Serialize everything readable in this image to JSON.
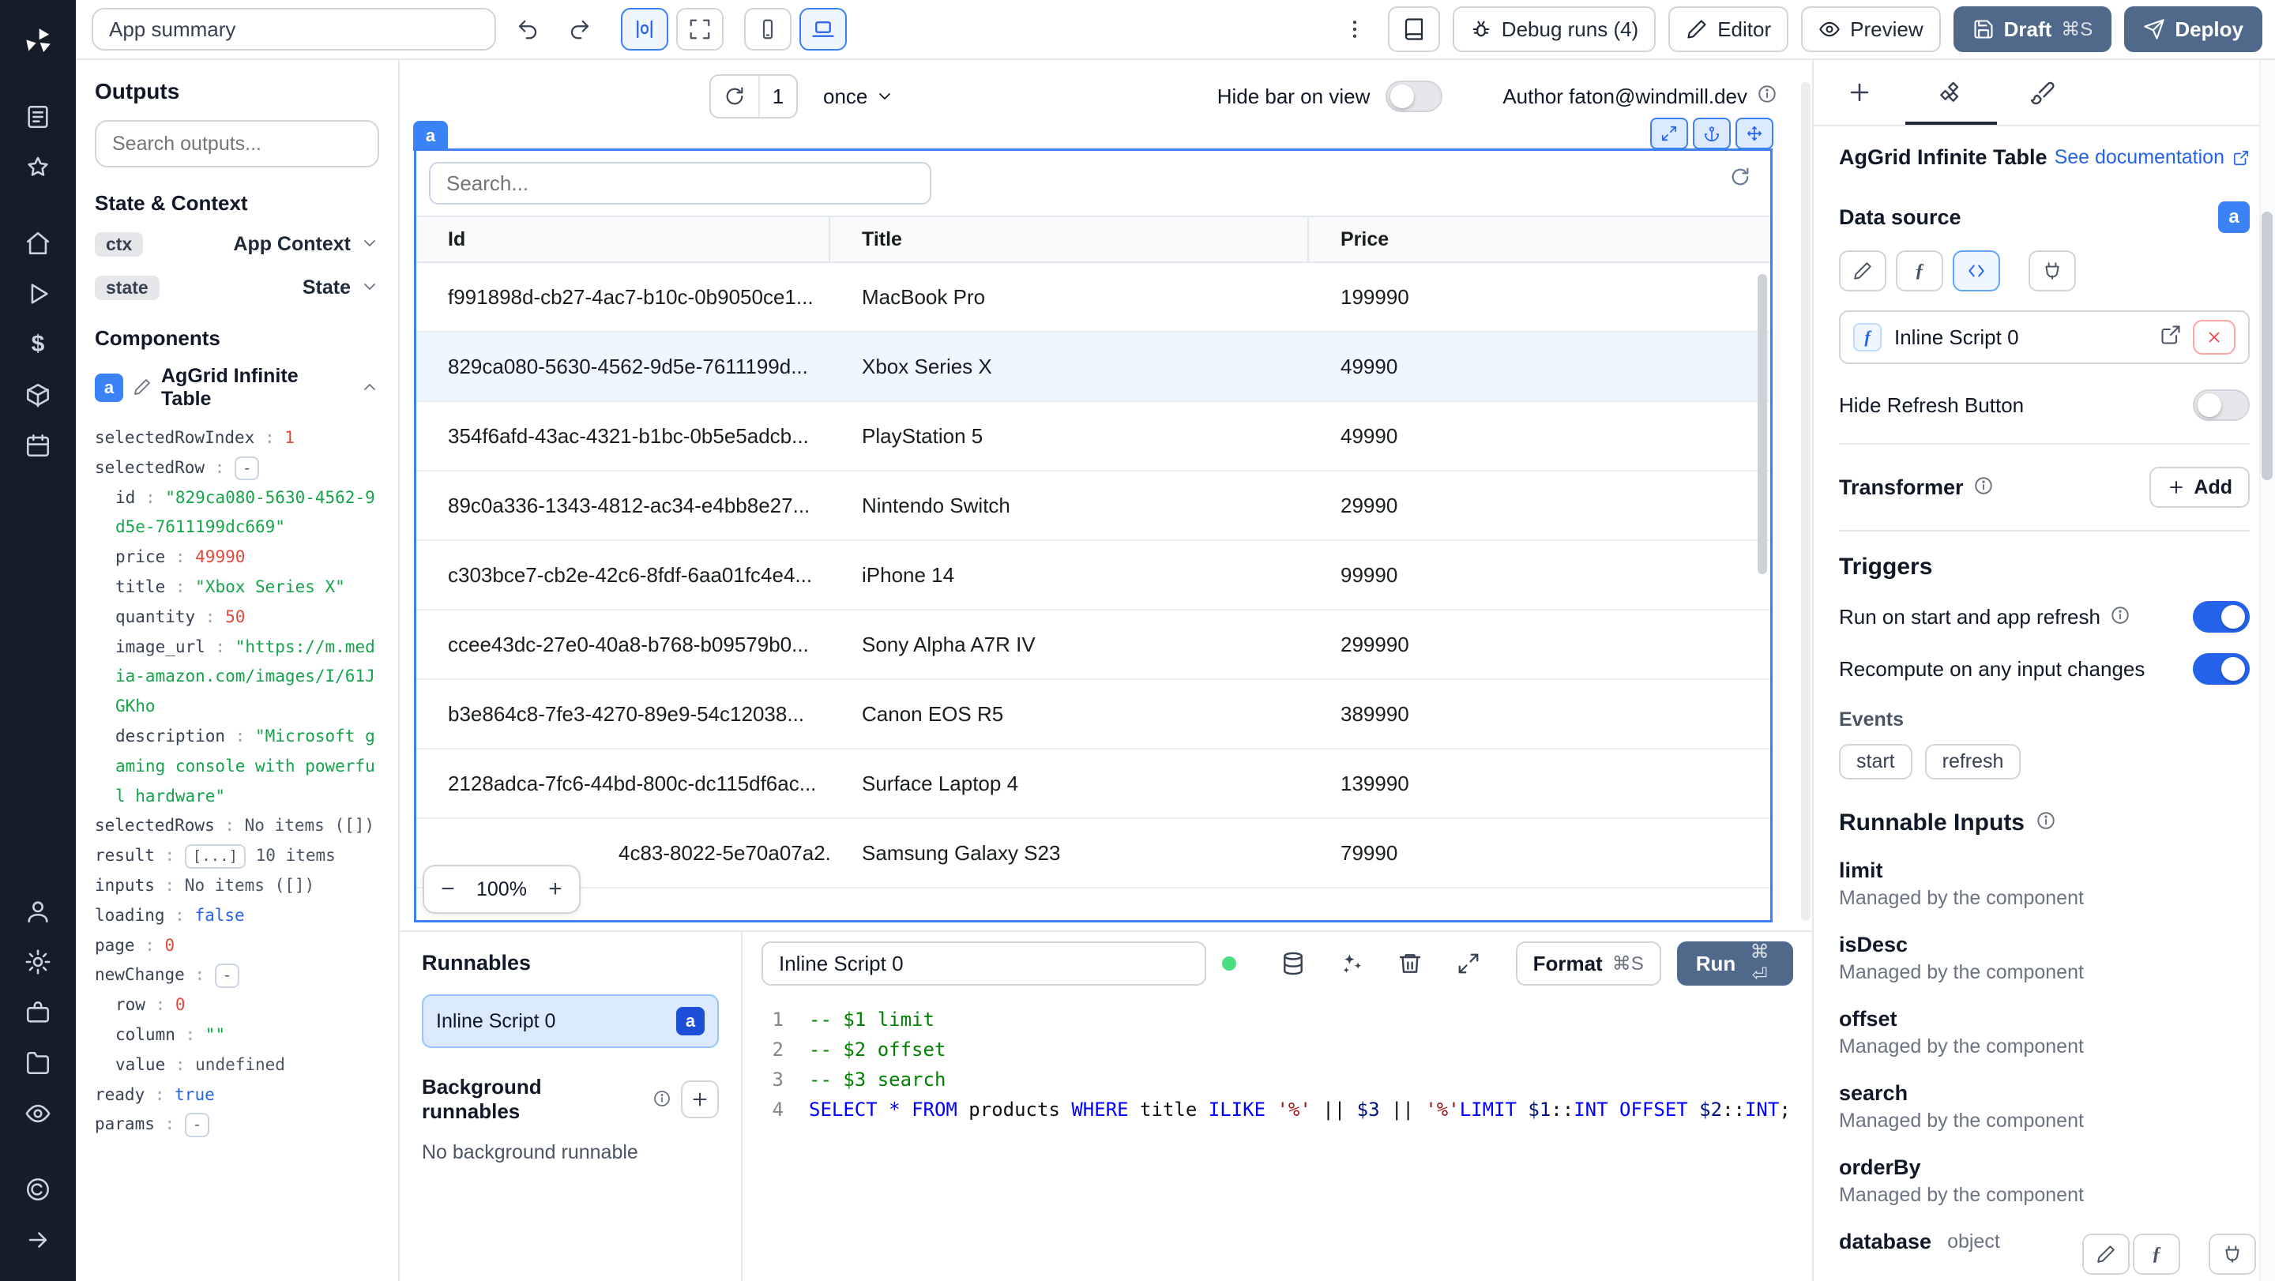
{
  "topbar": {
    "summary_value": "App summary",
    "debug_runs_label": "Debug runs (4)",
    "editor_label": "Editor",
    "preview_label": "Preview",
    "draft_label": "Draft",
    "draft_kbd": "⌘S",
    "deploy_label": "Deploy"
  },
  "outputs": {
    "title": "Outputs",
    "search_placeholder": "Search outputs...",
    "state_context_title": "State & Context",
    "ctx_key": "ctx",
    "ctx_value": "App Context",
    "state_key": "state",
    "state_value": "State",
    "components_title": "Components",
    "component_badge": "a",
    "component_title": "AgGrid Infinite Table",
    "tree": [
      {
        "key": "selectedRowIndex",
        "box": null,
        "value": "1",
        "type": "number",
        "indent": 0
      },
      {
        "key": "selectedRow",
        "box": "-",
        "value": "",
        "type": "plain",
        "indent": 0
      },
      {
        "key": "id",
        "box": null,
        "value": "\"829ca080-5630-4562-9d5e-7611199dc669\"",
        "type": "string",
        "indent": 1
      },
      {
        "key": "price",
        "box": null,
        "value": "49990",
        "type": "number",
        "indent": 1
      },
      {
        "key": "title",
        "box": null,
        "value": "\"Xbox Series X\"",
        "type": "string",
        "indent": 1
      },
      {
        "key": "quantity",
        "box": null,
        "value": "50",
        "type": "number",
        "indent": 1
      },
      {
        "key": "image_url",
        "box": null,
        "value": "\"https://m.media-amazon.com/images/I/61JGKho",
        "type": "string",
        "indent": 1
      },
      {
        "key": "description",
        "box": null,
        "value": "\"Microsoft gaming console with powerful hardware\"",
        "type": "string",
        "indent": 1
      },
      {
        "key": "selectedRows",
        "box": null,
        "value": "No items ([])",
        "type": "plain",
        "indent": 0
      },
      {
        "key": "result",
        "box": "[...]",
        "value": "10 items",
        "type": "plain",
        "indent": 0
      },
      {
        "key": "inputs",
        "box": null,
        "value": "No items ([])",
        "type": "plain",
        "indent": 0
      },
      {
        "key": "loading",
        "box": null,
        "value": "false",
        "type": "bool",
        "indent": 0
      },
      {
        "key": "page",
        "box": null,
        "value": "0",
        "type": "number",
        "indent": 0
      },
      {
        "key": "newChange",
        "box": "-",
        "value": "",
        "type": "plain",
        "indent": 0
      },
      {
        "key": "row",
        "box": null,
        "value": "0",
        "type": "number",
        "indent": 1
      },
      {
        "key": "column",
        "box": null,
        "value": "\"\"",
        "type": "string",
        "indent": 1
      },
      {
        "key": "value",
        "box": null,
        "value": "undefined",
        "type": "plain",
        "indent": 1
      },
      {
        "key": "ready",
        "box": null,
        "value": "true",
        "type": "bool",
        "indent": 0
      },
      {
        "key": "params",
        "box": "-",
        "value": "",
        "type": "plain",
        "indent": 0
      }
    ]
  },
  "canvas": {
    "refresh_count": "1",
    "interval_label": "once",
    "hide_bar_label": "Hide bar on view",
    "author_label": "Author faton@windmill.dev",
    "component_badge": "a",
    "zoom_value": "100%",
    "table": {
      "search_placeholder": "Search...",
      "columns": [
        "Id",
        "Title",
        "Price"
      ],
      "selected_row_index": 1,
      "cut_row_index": 8,
      "rows": [
        [
          "f991898d-cb27-4ac7-b10c-0b9050ce1...",
          "MacBook Pro",
          "199990"
        ],
        [
          "829ca080-5630-4562-9d5e-7611199d...",
          "Xbox Series X",
          "49990"
        ],
        [
          "354f6afd-43ac-4321-b1bc-0b5e5adcb...",
          "PlayStation 5",
          "49990"
        ],
        [
          "89c0a336-1343-4812-ac34-e4bb8e27...",
          "Nintendo Switch",
          "29990"
        ],
        [
          "c303bce7-cb2e-42c6-8fdf-6aa01fc4e4...",
          "iPhone 14",
          "99990"
        ],
        [
          "ccee43dc-27e0-40a8-b768-b09579b0...",
          "Sony Alpha A7R IV",
          "299990"
        ],
        [
          "b3e864c8-7fe3-4270-89e9-54c12038...",
          "Canon EOS R5",
          "389990"
        ],
        [
          "2128adca-7fc6-44bd-800c-dc115df6ac...",
          "Surface Laptop 4",
          "139990"
        ],
        [
          "4c83-8022-5e70a07a2...",
          "Samsung Galaxy S23",
          "79990"
        ]
      ]
    }
  },
  "runnables": {
    "title": "Runnables",
    "item_label": "Inline Script 0",
    "item_badge": "a",
    "background_title": "Background runnables",
    "background_empty": "No background runnable"
  },
  "editor": {
    "name_value": "Inline Script 0",
    "format_label": "Format",
    "format_kbd": "⌘S",
    "run_label": "Run",
    "run_kbd": "⌘ ⏎",
    "code_lines": [
      {
        "n": "1",
        "tokens": [
          {
            "t": "-- $1 limit",
            "c": "comment"
          }
        ]
      },
      {
        "n": "2",
        "tokens": [
          {
            "t": "-- $2 offset",
            "c": "comment"
          }
        ]
      },
      {
        "n": "3",
        "tokens": [
          {
            "t": "-- $3 search",
            "c": "comment"
          }
        ]
      },
      {
        "n": "4",
        "tokens": [
          {
            "t": "SELECT",
            "c": "kw"
          },
          {
            "t": " ",
            "c": "plain"
          },
          {
            "t": "*",
            "c": "kw"
          },
          {
            "t": " ",
            "c": "plain"
          },
          {
            "t": "FROM",
            "c": "kw"
          },
          {
            "t": " products ",
            "c": "plain"
          },
          {
            "t": "WHERE",
            "c": "kw"
          },
          {
            "t": " title ",
            "c": "plain"
          },
          {
            "t": "ILIKE",
            "c": "kw"
          },
          {
            "t": " ",
            "c": "plain"
          },
          {
            "t": "'%'",
            "c": "str"
          },
          {
            "t": " || ",
            "c": "plain"
          },
          {
            "t": "$3",
            "c": "var"
          },
          {
            "t": " || ",
            "c": "plain"
          },
          {
            "t": "'%'",
            "c": "str"
          },
          {
            "t": "LIMIT",
            "c": "kw"
          },
          {
            "t": " ",
            "c": "plain"
          },
          {
            "t": "$1",
            "c": "var"
          },
          {
            "t": "::",
            "c": "plain"
          },
          {
            "t": "INT",
            "c": "kw"
          },
          {
            "t": " ",
            "c": "plain"
          },
          {
            "t": "OFFSET",
            "c": "kw"
          },
          {
            "t": " ",
            "c": "plain"
          },
          {
            "t": "$2",
            "c": "var"
          },
          {
            "t": "::",
            "c": "plain"
          },
          {
            "t": "INT",
            "c": "kw"
          },
          {
            "t": ";",
            "c": "plain"
          }
        ]
      }
    ]
  },
  "right": {
    "component_title": "AgGrid Infinite Table",
    "doc_link": "See documentation",
    "data_source_label": "Data source",
    "badge": "a",
    "script_name": "Inline Script 0",
    "hide_refresh_label": "Hide Refresh Button",
    "transformer_label": "Transformer",
    "add_label": "Add",
    "triggers_title": "Triggers",
    "trigger1": "Run on start and app refresh",
    "trigger2": "Recompute on any input changes",
    "events_label": "Events",
    "event_chips": [
      "start",
      "refresh"
    ],
    "runnable_inputs_title": "Runnable Inputs",
    "inputs": [
      {
        "name": "limit",
        "desc": "Managed by the component"
      },
      {
        "name": "isDesc",
        "desc": "Managed by the component"
      },
      {
        "name": "offset",
        "desc": "Managed by the component"
      },
      {
        "name": "search",
        "desc": "Managed by the component"
      },
      {
        "name": "orderBy",
        "desc": "Managed by the component"
      }
    ],
    "database_label": "database",
    "database_type": "object"
  }
}
